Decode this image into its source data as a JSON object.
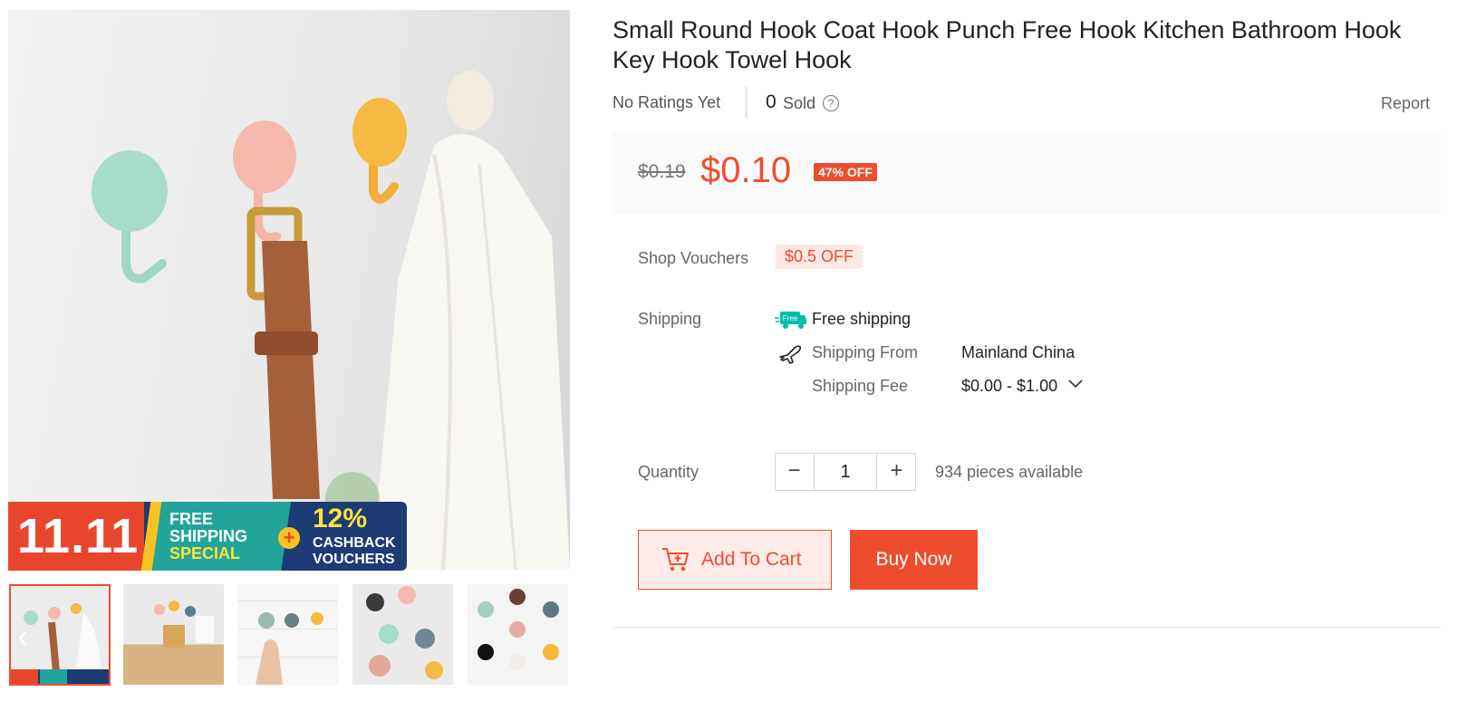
{
  "gallery": {
    "banner": {
      "date": "11.11",
      "shipping_line1": "FREE",
      "shipping_line2": "SHIPPING",
      "shipping_line3": "SPECIAL",
      "plus": "+",
      "cashback_pct": "12%",
      "cashback_line1": "CASHBACK",
      "cashback_line2": "VOUCHERS"
    },
    "prev_arrow": "‹",
    "thumbnails": [
      "thumbnail-1",
      "thumbnail-2",
      "thumbnail-3",
      "thumbnail-4",
      "thumbnail-5"
    ]
  },
  "product": {
    "title": "Small Round Hook Coat Hook Punch Free Hook Kitchen Bathroom Hook Key Hook Towel Hook",
    "ratings": "No Ratings Yet",
    "sold_count": "0",
    "sold_label": "Sold",
    "help": "?",
    "report": "Report"
  },
  "price": {
    "original": "$0.19",
    "current": "$0.10",
    "discount": "47% OFF"
  },
  "vouchers": {
    "label": "Shop Vouchers",
    "chip": "$0.5 OFF"
  },
  "shipping": {
    "label": "Shipping",
    "free_tag": "Free",
    "free_text": "Free shipping",
    "from_label": "Shipping From",
    "from_value": "Mainland China",
    "fee_label": "Shipping Fee",
    "fee_value": "$0.00 - $1.00"
  },
  "quantity": {
    "label": "Quantity",
    "minus": "−",
    "value": "1",
    "plus": "+",
    "available": "934 pieces available"
  },
  "actions": {
    "add_to_cart": "Add To Cart",
    "buy_now": "Buy Now"
  },
  "colors": {
    "accent": "#ee4d2d",
    "voucher_bg": "#fde8e4",
    "price_bg": "#fafafa"
  }
}
